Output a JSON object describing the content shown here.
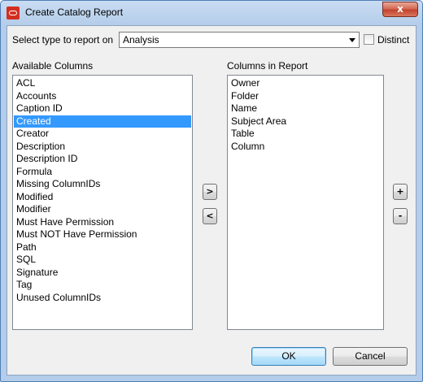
{
  "window": {
    "title": "Create Catalog Report",
    "close_label": "x"
  },
  "report_type": {
    "label": "Select type to report on",
    "selected": "Analysis",
    "distinct_label": "Distinct",
    "distinct_checked": false
  },
  "available": {
    "label": "Available Columns",
    "items": [
      "ACL",
      "Accounts",
      "Caption ID",
      "Created",
      "Creator",
      "Description",
      "Description ID",
      "Formula",
      "Missing ColumnIDs",
      "Modified",
      "Modifier",
      "Must Have Permission",
      "Must NOT Have Permission",
      "Path",
      "SQL",
      "Signature",
      "Tag",
      "Unused ColumnIDs"
    ],
    "selected": "Created"
  },
  "in_report": {
    "label": "Columns in Report",
    "items": [
      "Owner",
      "Folder",
      "Name",
      "Subject Area",
      "Table",
      "Column"
    ]
  },
  "buttons": {
    "add": ">",
    "remove": "<",
    "move_up": "+",
    "move_down": "-",
    "ok": "OK",
    "cancel": "Cancel"
  }
}
